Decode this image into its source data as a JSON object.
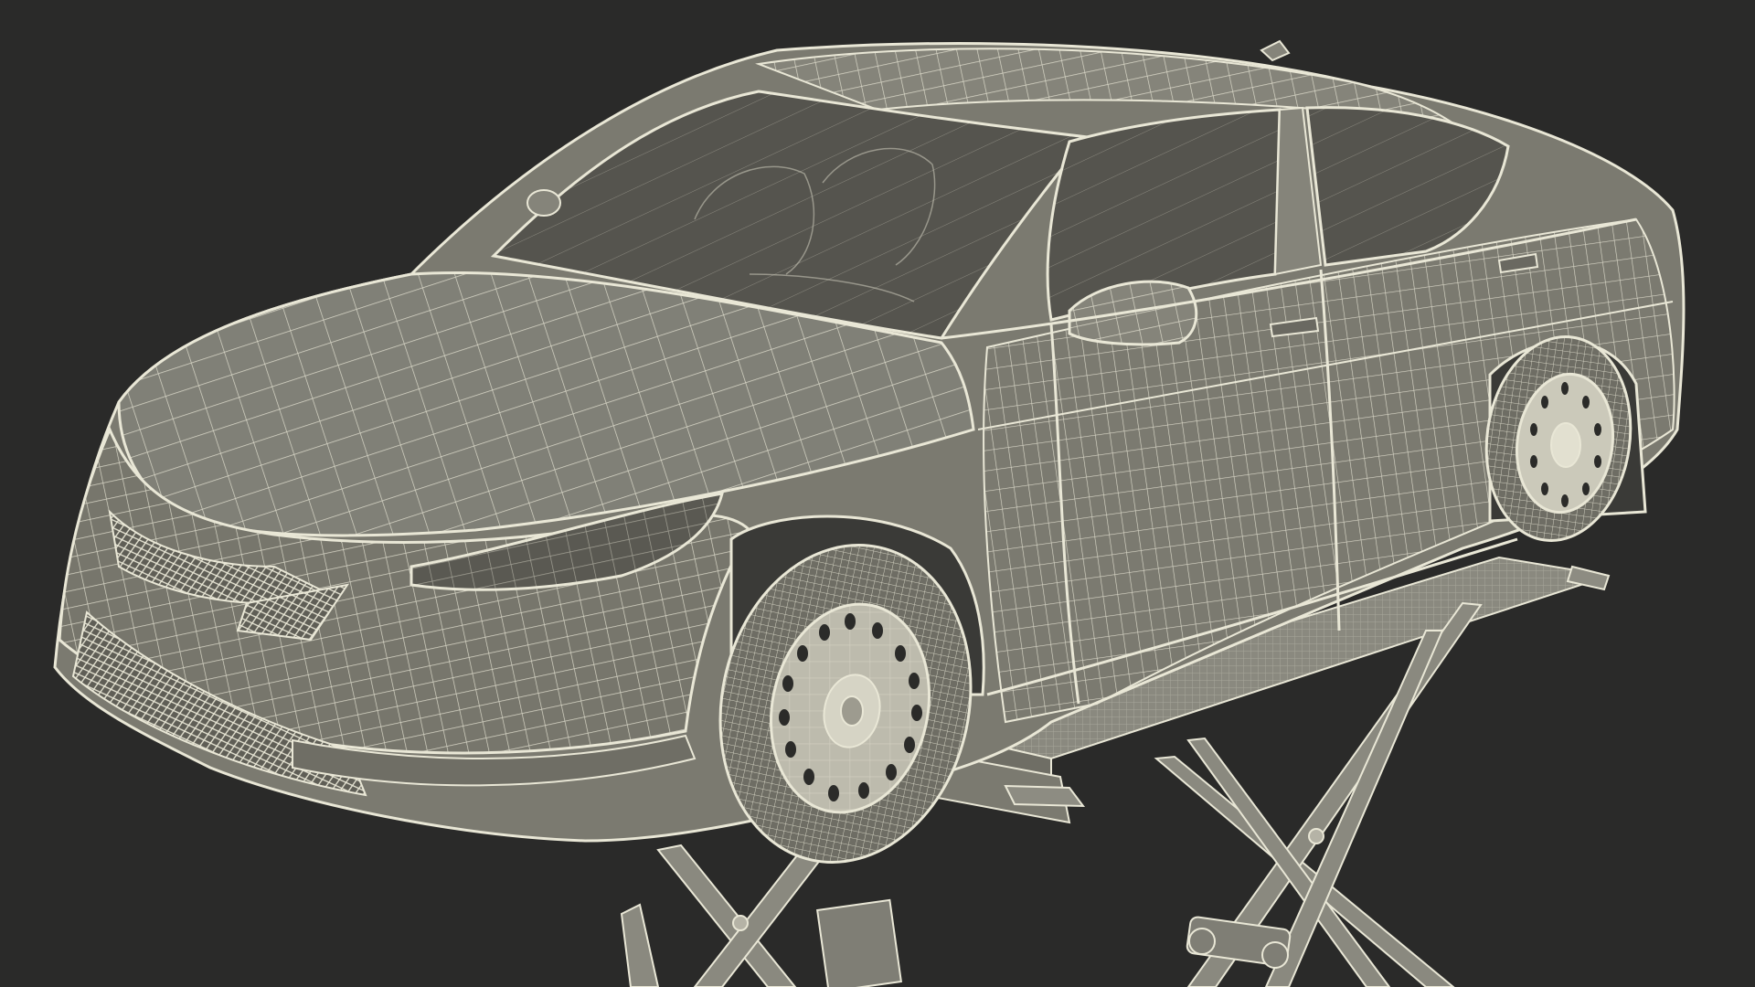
{
  "scene": {
    "subject": "wireframe-car-on-scissor-lift",
    "colors": {
      "background": "#2a2a29",
      "body_fill": "#7b7a70",
      "body_fill_dark": "#5f5e56",
      "glass_fill": "#55544e",
      "wire": "#e9e7d6",
      "wire_soft": "#cfcdbd",
      "lift_fill": "#8a897f",
      "tire_fill": "#6e6d64"
    }
  }
}
